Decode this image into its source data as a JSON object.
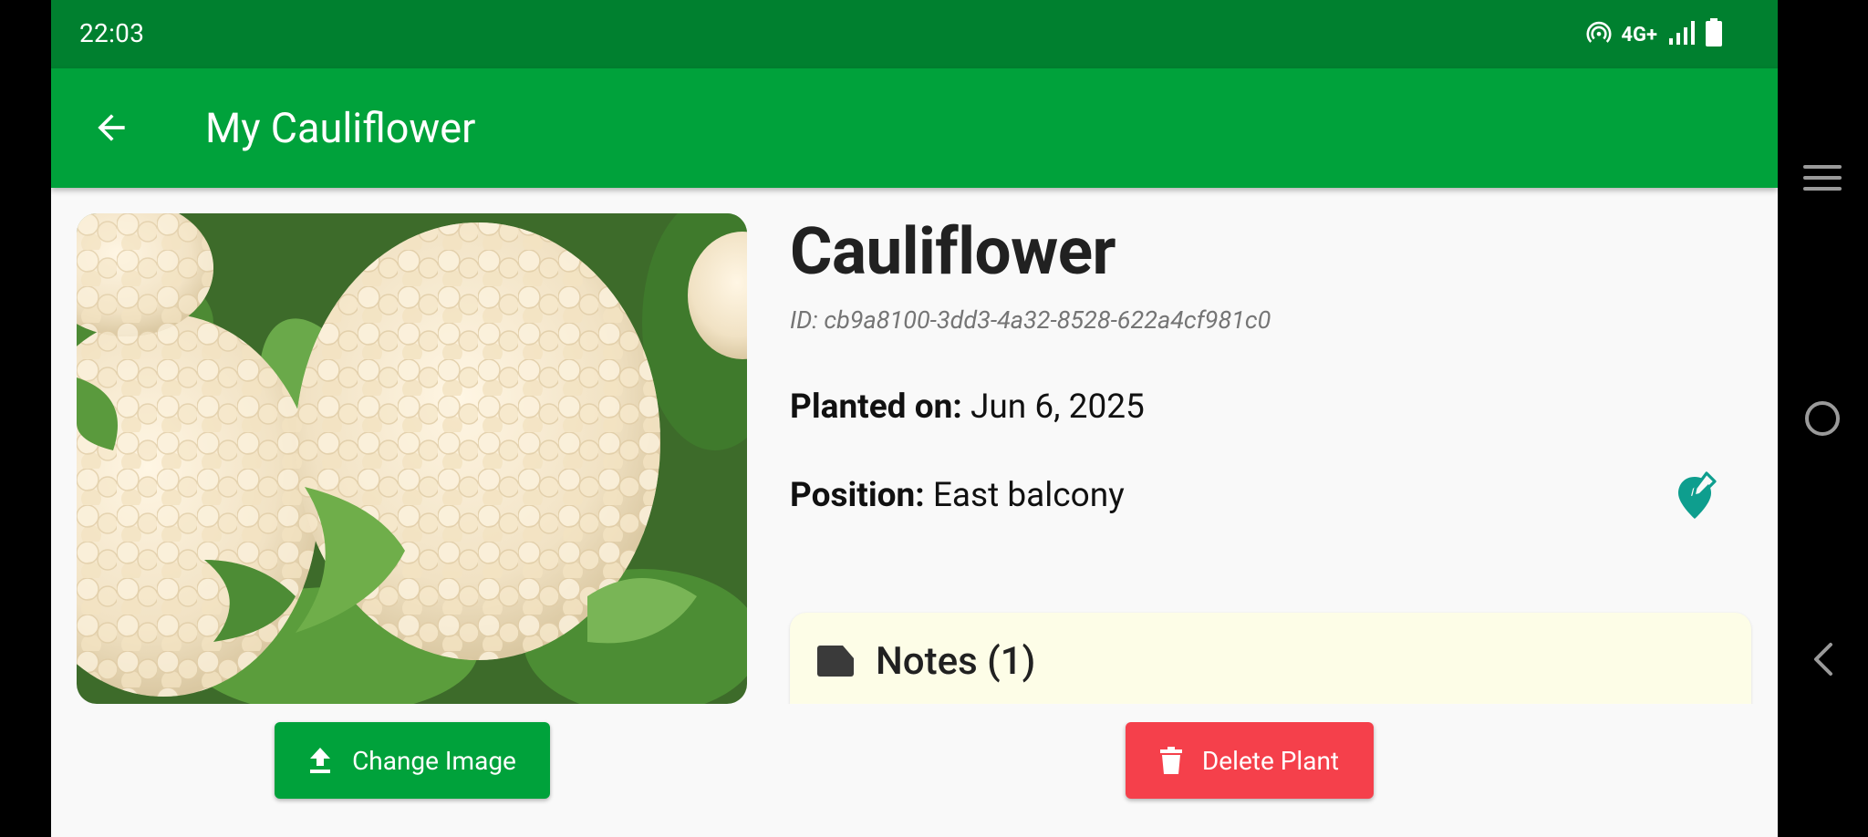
{
  "status_bar": {
    "time": "22:03",
    "network": "4G+",
    "icons": [
      "hotspot-icon",
      "signal-icon",
      "battery-icon"
    ]
  },
  "app_bar": {
    "title": "My Cauliflower",
    "back_icon": "arrow-left-icon"
  },
  "plant": {
    "name": "Cauliflower",
    "id_text": "ID: cb9a8100-3dd3-4a32-8528-622a4cf981c0",
    "planted_label": "Planted on:",
    "planted_value": "Jun 6, 2025",
    "position_label": "Position:",
    "position_value": "East balcony",
    "image_subject": "cauliflower heads"
  },
  "notes": {
    "title": "Notes (1)",
    "icon": "label-icon"
  },
  "buttons": {
    "change_image": "Change Image",
    "delete_plant": "Delete Plant"
  },
  "colors": {
    "status_bar": "#00802f",
    "app_bar": "#00a23b",
    "primary_button": "#00a23b",
    "danger_button": "#f5404b",
    "accent_icon": "#0e9e8e",
    "notes_card": "#fdfde7"
  },
  "nav": [
    "menu-icon",
    "home-icon",
    "back-icon"
  ]
}
